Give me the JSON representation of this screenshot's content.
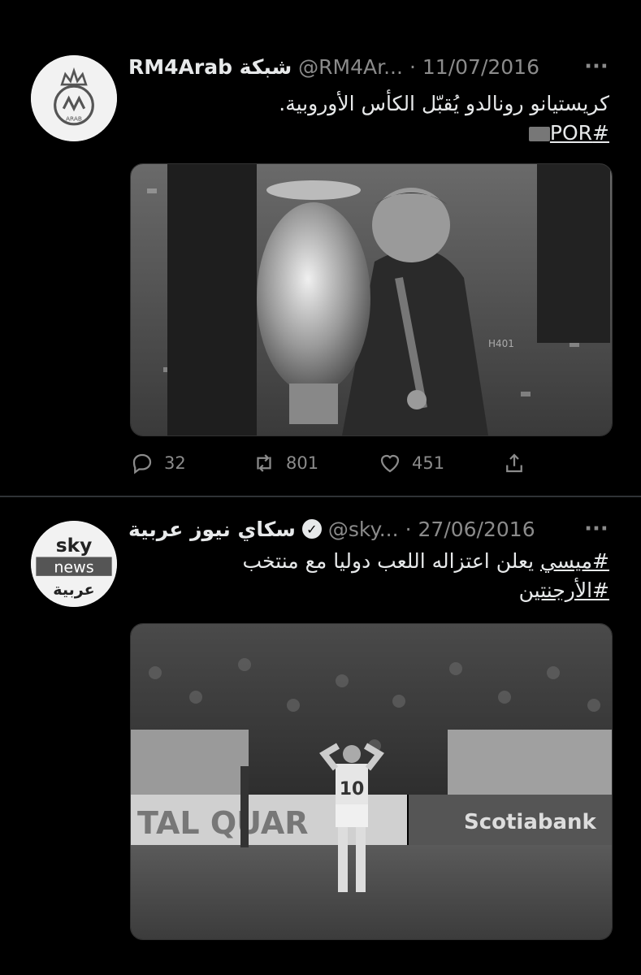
{
  "tweets": [
    {
      "display_name": "RM4Arab شبكة",
      "handle": "@RM4Ar...",
      "separator": "·",
      "date": "11/07/2016",
      "more_label": "···",
      "text": "كريستيانو رونالدو يُقبّل الكأس الأوروبية.",
      "hashtags": [
        "#POR"
      ],
      "avatar": "rm4arab-logo",
      "media": "ronaldo-kissing-euro-trophy-photo",
      "stats": {
        "replies": "32",
        "retweets": "801",
        "likes": "451"
      }
    },
    {
      "display_name": "سكاي نيوز عربية",
      "verified": true,
      "handle": "@sky...",
      "separator": "·",
      "date": "27/06/2016",
      "more_label": "···",
      "text_hashtag_lead": "#ميسي",
      "text": " يعلن اعتزاله اللعب دوليا مع منتخب",
      "hashtags": [
        "#الأرجنتين"
      ],
      "avatar": "sky-news-arabia-logo",
      "avatar_text": {
        "line1": "sky",
        "line2": "news",
        "line3": "عربية"
      },
      "media": "messi-on-pitch-photo",
      "media_text": {
        "jersey": "10",
        "board_left": "TAL QUAR",
        "board_right": "Scotiabank"
      }
    }
  ],
  "icons": {
    "reply": "reply-icon",
    "retweet": "retweet-icon",
    "like": "heart-icon",
    "share": "share-icon",
    "verified": "verified-badge-icon"
  },
  "colors": {
    "background": "#000000",
    "text": "#e7e9ea",
    "muted": "#8b8b8b",
    "divider": "#2f3336"
  }
}
